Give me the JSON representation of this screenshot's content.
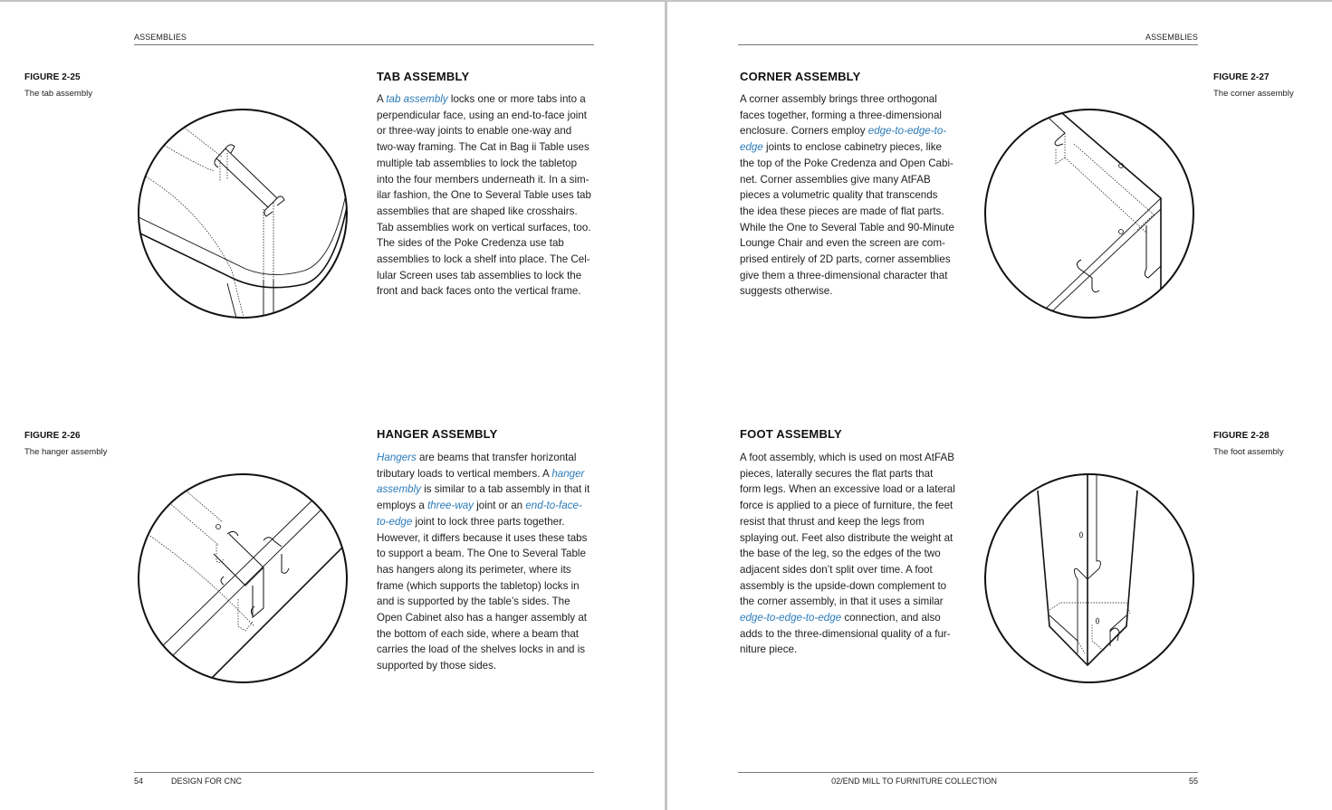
{
  "colors": {
    "link": "#2b7bb9",
    "text": "#1d1d1d",
    "rule": "#777777",
    "spine": "#c4c4c4"
  },
  "left_page": {
    "running_head": "ASSEMBLIES",
    "footer": {
      "page_number": "54",
      "book_title": "DESIGN FOR CNC"
    },
    "figures": [
      {
        "label": "FIGURE 2-25",
        "caption": "The tab assembly",
        "illustration": "tab-assembly-drawing"
      },
      {
        "label": "FIGURE 2-26",
        "caption": "The hanger assembly",
        "illustration": "hanger-assembly-drawing"
      }
    ],
    "sections": [
      {
        "title": "TAB ASSEMBLY",
        "lines": [
          [
            {
              "t": "A "
            },
            {
              "t": "tab assembly",
              "term": true
            },
            {
              "t": " locks one or more tabs into a"
            }
          ],
          [
            {
              "t": "perpendicular face, using an end-to-face joint"
            }
          ],
          [
            {
              "t": "or three-way joints to enable one-way and"
            }
          ],
          [
            {
              "t": "two-way framing. The Cat in Bag ii Table uses"
            }
          ],
          [
            {
              "t": "multiple tab assemblies to lock the tabletop"
            }
          ],
          [
            {
              "t": "into the four members underneath it. In a sim-"
            }
          ],
          [
            {
              "t": "ilar fashion, the One to Several Table uses tab"
            }
          ],
          [
            {
              "t": "assemblies that are shaped like crosshairs."
            }
          ],
          [
            {
              "t": "Tab assemblies work on vertical surfaces, too."
            }
          ],
          [
            {
              "t": "The sides of the Poke Credenza use tab"
            }
          ],
          [
            {
              "t": "assemblies to lock a shelf into place. The Cel-"
            }
          ],
          [
            {
              "t": "lular Screen uses tab assemblies to lock the"
            }
          ],
          [
            {
              "t": "front and back faces onto the vertical frame."
            }
          ]
        ]
      },
      {
        "title": "HANGER ASSEMBLY",
        "lines": [
          [
            {
              "t": "Hangers",
              "term": true
            },
            {
              "t": " are beams that transfer horizontal"
            }
          ],
          [
            {
              "t": "tributary loads to vertical members. A "
            },
            {
              "t": "hanger",
              "term": true
            }
          ],
          [
            {
              "t": "assembly",
              "term": true
            },
            {
              "t": " is similar to a tab assembly in that it"
            }
          ],
          [
            {
              "t": "employs a "
            },
            {
              "t": "three-way",
              "term": true
            },
            {
              "t": " joint or an "
            },
            {
              "t": "end-to-face-",
              "term": true
            }
          ],
          [
            {
              "t": "to-edge",
              "term": true
            },
            {
              "t": " joint to lock three parts together."
            }
          ],
          [
            {
              "t": "However, it differs because it uses these tabs"
            }
          ],
          [
            {
              "t": "to support a beam. The One to Several Table"
            }
          ],
          [
            {
              "t": "has hangers along its perimeter, where its"
            }
          ],
          [
            {
              "t": "frame (which supports the tabletop) locks in"
            }
          ],
          [
            {
              "t": "and is supported by the table’s sides. The"
            }
          ],
          [
            {
              "t": "Open Cabinet also has a hanger assembly at"
            }
          ],
          [
            {
              "t": "the bottom of each side, where a beam that"
            }
          ],
          [
            {
              "t": "carries the load of the shelves locks in and is"
            }
          ],
          [
            {
              "t": "supported by those sides."
            }
          ]
        ]
      }
    ]
  },
  "right_page": {
    "running_head": "ASSEMBLIES",
    "footer": {
      "page_number": "55",
      "chapter_title": "02/END MILL TO FURNITURE COLLECTION"
    },
    "figures": [
      {
        "label": "FIGURE 2-27",
        "caption": "The corner assembly",
        "illustration": "corner-assembly-drawing"
      },
      {
        "label": "FIGURE 2-28",
        "caption": "The foot assembly",
        "illustration": "foot-assembly-drawing"
      }
    ],
    "sections": [
      {
        "title": "CORNER ASSEMBLY",
        "lines": [
          [
            {
              "t": "A corner assembly brings three orthogonal"
            }
          ],
          [
            {
              "t": "faces together, forming a three-dimensional"
            }
          ],
          [
            {
              "t": "enclosure. Corners employ "
            },
            {
              "t": "edge-to-edge-to-",
              "term": true
            }
          ],
          [
            {
              "t": "edge",
              "term": true
            },
            {
              "t": " joints to enclose cabinetry pieces, like"
            }
          ],
          [
            {
              "t": "the top of the Poke Credenza and Open Cabi-"
            }
          ],
          [
            {
              "t": "net. Corner assemblies give many AtFAB"
            }
          ],
          [
            {
              "t": "pieces a volumetric quality that transcends"
            }
          ],
          [
            {
              "t": "the idea these pieces are made of flat parts."
            }
          ],
          [
            {
              "t": "While the One to Several Table and 90-Minute"
            }
          ],
          [
            {
              "t": "Lounge Chair and even the screen are com-"
            }
          ],
          [
            {
              "t": "prised entirely of 2D parts, corner assemblies"
            }
          ],
          [
            {
              "t": "give them a three-dimensional character that"
            }
          ],
          [
            {
              "t": "suggests otherwise."
            }
          ]
        ]
      },
      {
        "title": "FOOT ASSEMBLY",
        "lines": [
          [
            {
              "t": "A foot assembly, which is used on most AtFAB"
            }
          ],
          [
            {
              "t": "pieces, laterally secures the flat parts that"
            }
          ],
          [
            {
              "t": "form legs. When an excessive load or a lateral"
            }
          ],
          [
            {
              "t": "force is applied to a piece of furniture, the feet"
            }
          ],
          [
            {
              "t": "resist that thrust and keep the legs from"
            }
          ],
          [
            {
              "t": "splaying out. Feet also distribute the weight at"
            }
          ],
          [
            {
              "t": "the base of the leg, so the edges of the two"
            }
          ],
          [
            {
              "t": "adjacent sides don’t split over time. A foot"
            }
          ],
          [
            {
              "t": "assembly is the upside-down complement to"
            }
          ],
          [
            {
              "t": "the corner assembly, in that it uses a similar"
            }
          ],
          [
            {
              "t": "edge-to-edge-to-edge",
              "term": true
            },
            {
              "t": " connection, and also"
            }
          ],
          [
            {
              "t": "adds to the three-dimensional quality of a fur-"
            }
          ],
          [
            {
              "t": "niture piece."
            }
          ]
        ]
      }
    ]
  }
}
